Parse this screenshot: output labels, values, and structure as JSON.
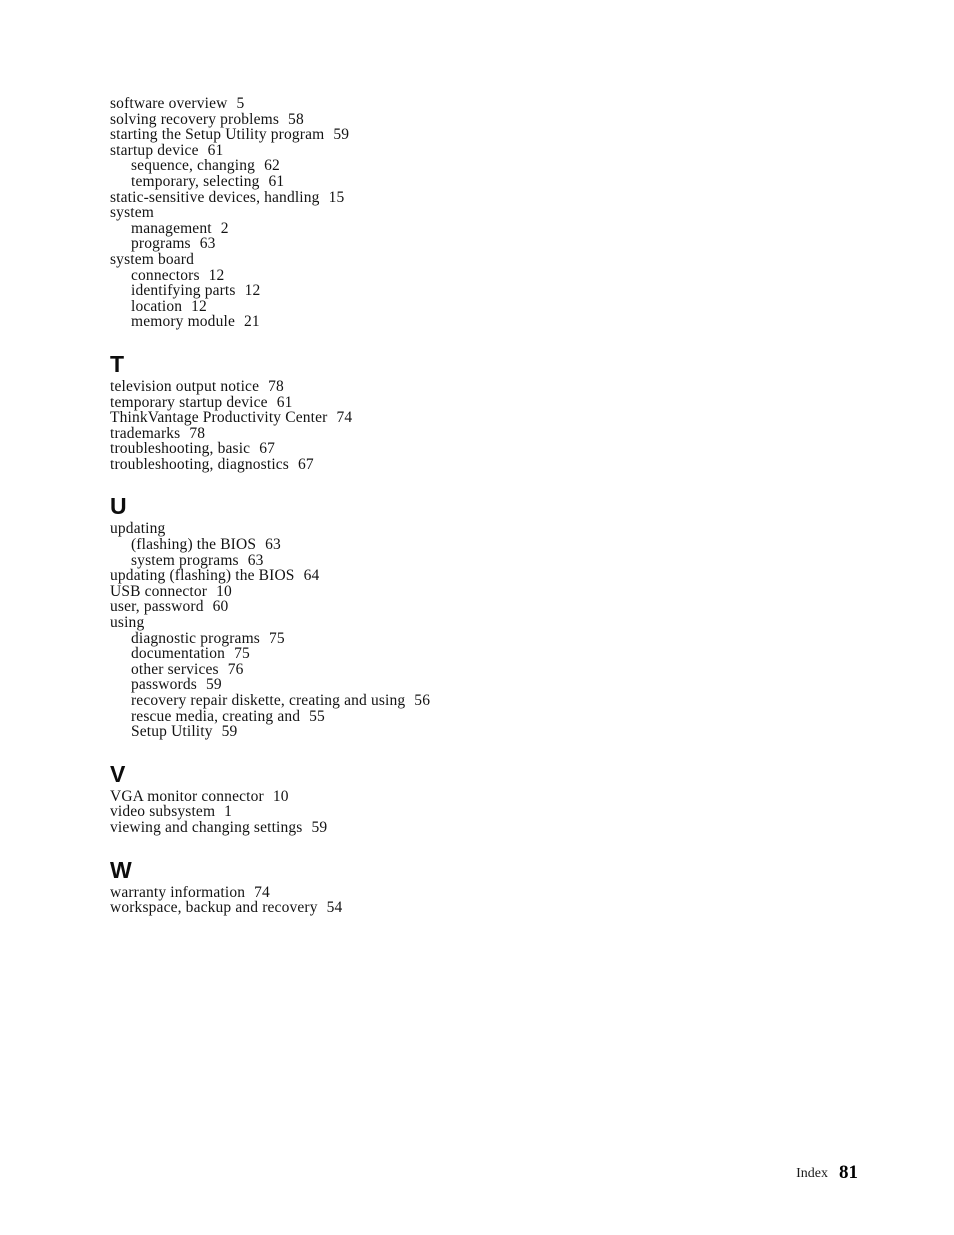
{
  "document": {
    "footer": {
      "label": "Index",
      "page_number": "81"
    }
  },
  "index": {
    "sections": [
      {
        "heading": "",
        "entries": [
          {
            "level": 1,
            "text": "software overview",
            "page": "5"
          },
          {
            "level": 1,
            "text": "solving recovery problems",
            "page": "58"
          },
          {
            "level": 1,
            "text": "starting the Setup Utility program",
            "page": "59"
          },
          {
            "level": 1,
            "text": "startup device",
            "page": "61"
          },
          {
            "level": 2,
            "text": "sequence, changing",
            "page": "62"
          },
          {
            "level": 2,
            "text": "temporary, selecting",
            "page": "61"
          },
          {
            "level": 1,
            "text": "static-sensitive devices, handling",
            "page": "15"
          },
          {
            "level": 1,
            "text": "system",
            "page": ""
          },
          {
            "level": 2,
            "text": "management",
            "page": "2"
          },
          {
            "level": 2,
            "text": "programs",
            "page": "63"
          },
          {
            "level": 1,
            "text": "system board",
            "page": ""
          },
          {
            "level": 2,
            "text": "connectors",
            "page": "12"
          },
          {
            "level": 2,
            "text": "identifying parts",
            "page": "12"
          },
          {
            "level": 2,
            "text": "location",
            "page": "12"
          },
          {
            "level": 2,
            "text": "memory module",
            "page": "21"
          }
        ]
      },
      {
        "heading": "T",
        "entries": [
          {
            "level": 1,
            "text": "television output notice",
            "page": "78"
          },
          {
            "level": 1,
            "text": "temporary startup device",
            "page": "61"
          },
          {
            "level": 1,
            "text": "ThinkVantage Productivity Center",
            "page": "74"
          },
          {
            "level": 1,
            "text": "trademarks",
            "page": "78"
          },
          {
            "level": 1,
            "text": "troubleshooting, basic",
            "page": "67"
          },
          {
            "level": 1,
            "text": "troubleshooting, diagnostics",
            "page": "67"
          }
        ]
      },
      {
        "heading": "U",
        "entries": [
          {
            "level": 1,
            "text": "updating",
            "page": ""
          },
          {
            "level": 2,
            "text": "(flashing) the BIOS",
            "page": "63"
          },
          {
            "level": 2,
            "text": "system programs",
            "page": "63"
          },
          {
            "level": 1,
            "text": "updating (flashing) the BIOS",
            "page": "64"
          },
          {
            "level": 1,
            "text": "USB connector",
            "page": "10"
          },
          {
            "level": 1,
            "text": "user, password",
            "page": "60"
          },
          {
            "level": 1,
            "text": "using",
            "page": ""
          },
          {
            "level": 2,
            "text": "diagnostic programs",
            "page": "75"
          },
          {
            "level": 2,
            "text": "documentation",
            "page": "75"
          },
          {
            "level": 2,
            "text": "other services",
            "page": "76"
          },
          {
            "level": 2,
            "text": "passwords",
            "page": "59"
          },
          {
            "level": 2,
            "text": "recovery repair diskette, creating and using",
            "page": "56"
          },
          {
            "level": 2,
            "text": "rescue media, creating and",
            "page": "55"
          },
          {
            "level": 2,
            "text": "Setup Utility",
            "page": "59"
          }
        ]
      },
      {
        "heading": "V",
        "entries": [
          {
            "level": 1,
            "text": "VGA monitor connector",
            "page": "10"
          },
          {
            "level": 1,
            "text": "video subsystem",
            "page": "1"
          },
          {
            "level": 1,
            "text": "viewing and changing settings",
            "page": "59"
          }
        ]
      },
      {
        "heading": "W",
        "entries": [
          {
            "level": 1,
            "text": "warranty information",
            "page": "74"
          },
          {
            "level": 1,
            "text": "workspace, backup and recovery",
            "page": "54"
          }
        ]
      }
    ]
  }
}
